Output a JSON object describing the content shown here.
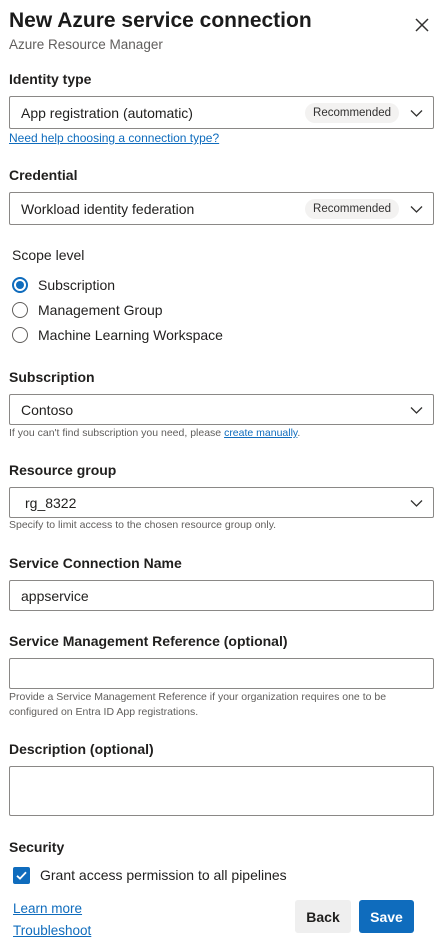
{
  "header": {
    "title": "New Azure service connection",
    "subtitle": "Azure Resource Manager"
  },
  "identity_type": {
    "label": "Identity type",
    "value": "App registration (automatic)",
    "badge": "Recommended",
    "help_link": "Need help choosing a connection type?"
  },
  "credential": {
    "label": "Credential",
    "value": "Workload identity federation",
    "badge": "Recommended"
  },
  "scope_level": {
    "label": "Scope level",
    "options": [
      {
        "label": "Subscription",
        "checked": true
      },
      {
        "label": "Management Group",
        "checked": false
      },
      {
        "label": "Machine Learning Workspace",
        "checked": false
      }
    ]
  },
  "subscription": {
    "label": "Subscription",
    "value": "Contoso",
    "hint": "If you can't find subscription you need, please",
    "hint_link": "create manually",
    "hint_end": "."
  },
  "resource_group": {
    "label": "Resource group",
    "value": "rg_8322",
    "hint": "Specify to limit access to the chosen resource group only."
  },
  "service_connection_name": {
    "label": "Service Connection Name",
    "value": "appservice"
  },
  "service_management_reference": {
    "label": "Service Management Reference (optional)",
    "value": "",
    "hint_line1": "Provide a Service Management Reference if your organization requires one to be",
    "hint_line2": "configured on Entra ID App registrations."
  },
  "description": {
    "label": "Description (optional)",
    "value": ""
  },
  "security": {
    "label": "Security",
    "grant_label": "Grant access permission to all pipelines",
    "grant_checked": true
  },
  "footer": {
    "learn_more": "Learn more",
    "troubleshoot": "Troubleshoot",
    "back_label": "Back",
    "save_label": "Save"
  },
  "colors": {
    "accent": "#0f6cbd",
    "border": "#8a8886"
  }
}
